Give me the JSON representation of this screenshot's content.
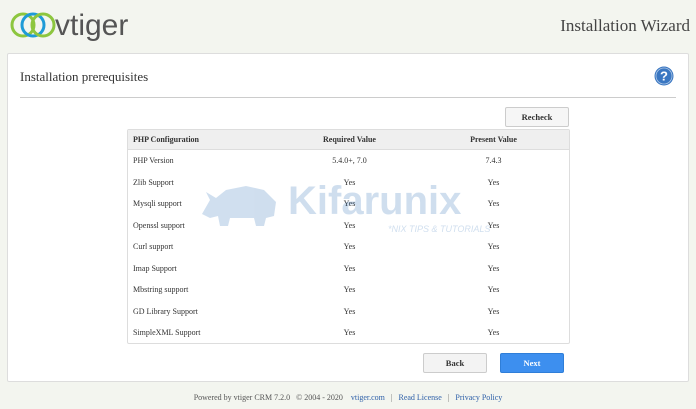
{
  "header": {
    "logo_text": "vtiger",
    "wizard_title": "Installation Wizard"
  },
  "panel": {
    "title": "Installation prerequisites",
    "help_icon": "question-circle-icon",
    "recheck_label": "Recheck",
    "back_label": "Back",
    "next_label": "Next"
  },
  "table": {
    "headers": [
      "PHP Configuration",
      "Required Value",
      "Present Value"
    ],
    "rows": [
      [
        "PHP Version",
        "5.4.0+, 7.0",
        "7.4.3"
      ],
      [
        "Zlib Support",
        "Yes",
        "Yes"
      ],
      [
        "Mysqli support",
        "Yes",
        "Yes"
      ],
      [
        "Openssl support",
        "Yes",
        "Yes"
      ],
      [
        "Curl support",
        "Yes",
        "Yes"
      ],
      [
        "Imap Support",
        "Yes",
        "Yes"
      ],
      [
        "Mbstring support",
        "Yes",
        "Yes"
      ],
      [
        "GD Library Support",
        "Yes",
        "Yes"
      ],
      [
        "SimpleXML Support",
        "Yes",
        "Yes"
      ]
    ]
  },
  "watermark": {
    "name": "Kifarunix",
    "tagline": "*NIX TIPS & TUTORIALS"
  },
  "footer": {
    "powered_by": "Powered by vtiger CRM 7.2.0",
    "copyright": "© 2004 - 2020",
    "site_link": "vtiger.com",
    "license_link": "Read License",
    "privacy_link": "Privacy Policy",
    "separator": "|"
  },
  "colors": {
    "accent": "#3d8fef",
    "logo_green": "#8dc63f",
    "logo_blue": "#1f9bd7",
    "link": "#2d5fa8",
    "help_icon": "#3a77c2"
  }
}
